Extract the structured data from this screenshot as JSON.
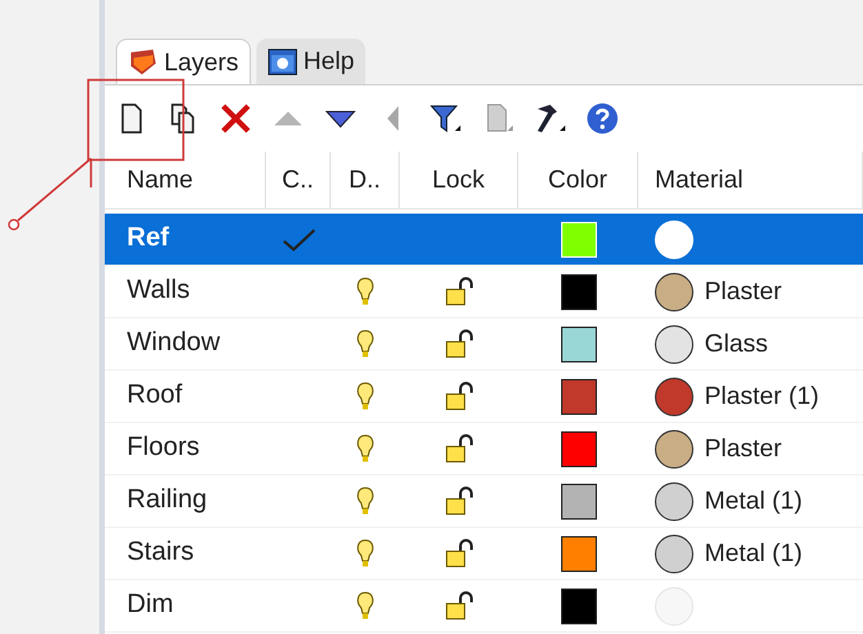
{
  "tabs": [
    {
      "label": "Layers",
      "kind": "layers",
      "selected": true
    },
    {
      "label": "Help",
      "kind": "help",
      "selected": false
    }
  ],
  "toolbar": [
    {
      "kind": "new",
      "disabled": false
    },
    {
      "kind": "copy",
      "disabled": false
    },
    {
      "kind": "delete",
      "disabled": false
    },
    {
      "kind": "up",
      "disabled": true
    },
    {
      "kind": "down",
      "disabled": false
    },
    {
      "kind": "left",
      "disabled": true
    },
    {
      "kind": "filter",
      "disabled": false
    },
    {
      "kind": "page",
      "disabled": true
    },
    {
      "kind": "tools",
      "disabled": false
    },
    {
      "kind": "help",
      "disabled": false
    }
  ],
  "columns": [
    "Name",
    "C..",
    "D..",
    "Lock",
    "Color",
    "Material"
  ],
  "rows": [
    {
      "name": "Ref",
      "selected": true,
      "current": true,
      "color": "#80ff00",
      "material": {
        "color": "#ffffff"
      }
    },
    {
      "name": "Walls",
      "selected": false,
      "current": false,
      "visible": true,
      "locked": false,
      "color": "#000000",
      "material": {
        "name": "Plaster",
        "color": "#c8ad85"
      }
    },
    {
      "name": "Window",
      "selected": false,
      "current": false,
      "visible": true,
      "locked": false,
      "color": "#99d6d6",
      "material": {
        "name": "Glass",
        "color": "#e3e3e3"
      }
    },
    {
      "name": "Roof",
      "selected": false,
      "current": false,
      "visible": true,
      "locked": false,
      "color": "#c0392b",
      "material": {
        "name": "Plaster (1)",
        "color": "#c0392b"
      }
    },
    {
      "name": "Floors",
      "selected": false,
      "current": false,
      "visible": true,
      "locked": false,
      "color": "#ff0000",
      "material": {
        "name": "Plaster",
        "color": "#c8ad85"
      }
    },
    {
      "name": "Railing",
      "selected": false,
      "current": false,
      "visible": true,
      "locked": false,
      "color": "#b3b3b3",
      "material": {
        "name": "Metal (1)",
        "color": "#d0d0d0"
      }
    },
    {
      "name": "Stairs",
      "selected": false,
      "current": false,
      "visible": true,
      "locked": false,
      "color": "#ff8000",
      "material": {
        "name": "Metal (1)",
        "color": "#d0d0d0"
      }
    },
    {
      "name": "Dim",
      "selected": false,
      "current": false,
      "visible": true,
      "locked": false,
      "color": "#000000",
      "material": {
        "color": "#f7f7f7"
      }
    }
  ]
}
